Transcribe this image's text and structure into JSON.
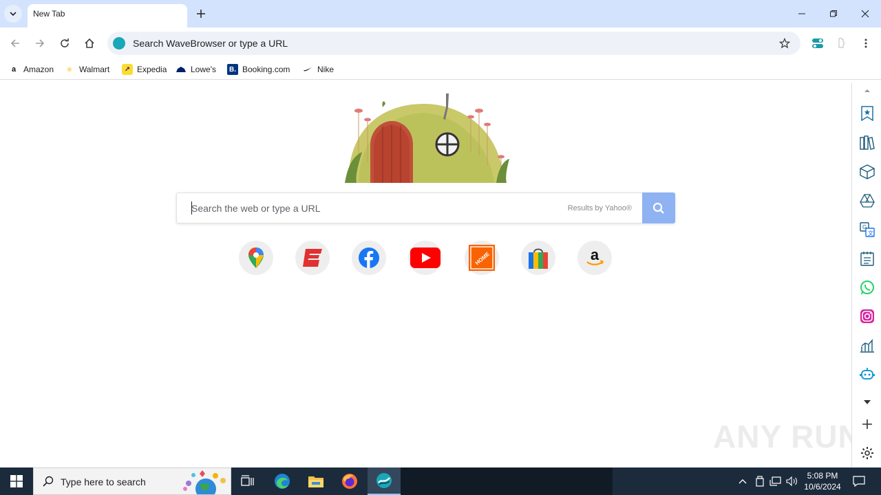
{
  "tab": {
    "title": "New Tab"
  },
  "omnibox": {
    "text": "Search WaveBrowser or type a URL"
  },
  "bookmarks": [
    {
      "label": "Amazon",
      "icon": "amazon-icon"
    },
    {
      "label": "Walmart",
      "icon": "walmart-icon"
    },
    {
      "label": "Expedia",
      "icon": "expedia-icon"
    },
    {
      "label": "Lowe's",
      "icon": "lowes-icon"
    },
    {
      "label": "Booking.com",
      "icon": "booking-icon"
    },
    {
      "label": "Nike",
      "icon": "nike-icon"
    }
  ],
  "search": {
    "placeholder": "Search the web or type a URL",
    "results_by": "Results by Yahoo®"
  },
  "shortcuts": [
    {
      "name": "google-maps"
    },
    {
      "name": "espn"
    },
    {
      "name": "facebook"
    },
    {
      "name": "youtube"
    },
    {
      "name": "the-home-depot"
    },
    {
      "name": "shopping-bag"
    },
    {
      "name": "amazon"
    }
  ],
  "sidebar_icons": [
    "bookmark-star-icon",
    "books-icon",
    "box-icon",
    "triangle-icon",
    "translate-icon",
    "checklist-icon",
    "whatsapp-icon",
    "instagram-icon",
    "chart-icon",
    "robot-icon",
    "chevron-down-icon",
    "plus-icon",
    "settings-icon"
  ],
  "taskbar": {
    "search_placeholder": "Type here to search",
    "time": "5:08 PM",
    "date": "10/6/2024"
  },
  "watermark": "ANY RUN"
}
